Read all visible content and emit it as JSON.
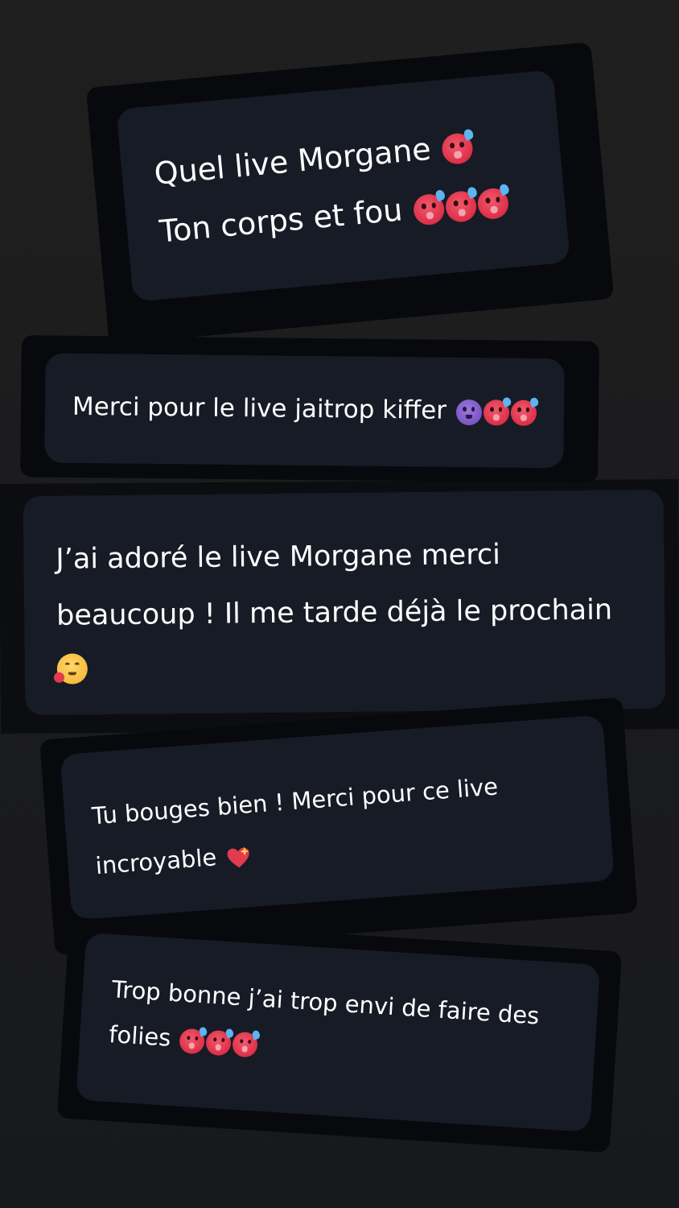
{
  "messages": [
    {
      "lines": [
        "Quel live Morgane",
        "Ton corps et fou"
      ],
      "emojis": [
        [
          "hot-face-emoji"
        ],
        [
          "hot-face-emoji",
          "hot-face-emoji",
          "hot-face-emoji"
        ]
      ]
    },
    {
      "lines": [
        "Merci pour le live jaitrop kiffer"
      ],
      "emojis": [
        [
          "smiling-devil-emoji",
          "hot-face-emoji",
          "hot-face-emoji"
        ]
      ]
    },
    {
      "lines": [
        "J’ai adoré le live Morgane merci",
        "beaucoup ! Il me tarde déjà le prochain",
        ""
      ],
      "emojis": [
        [],
        [],
        [
          "smiling-face-with-hearts-emoji"
        ]
      ]
    },
    {
      "lines": [
        "Tu bouges bien ! Merci pour ce live",
        "incroyable"
      ],
      "emojis": [
        [],
        [
          "sparkling-heart-emoji"
        ]
      ]
    },
    {
      "lines": [
        "Trop bonne j’ai trop envi de faire des",
        "folies"
      ],
      "emojis": [
        [],
        [
          "hot-face-emoji",
          "hot-face-emoji",
          "hot-face-emoji"
        ]
      ]
    }
  ],
  "colors": {
    "background": "#1e1f21",
    "bubble": "#171b26",
    "bubble_shadow": "#07090d",
    "text": "#ffffff",
    "hot_face": "#dc2f48",
    "devil": "#7a55c4",
    "heart": "#e23a4e"
  }
}
